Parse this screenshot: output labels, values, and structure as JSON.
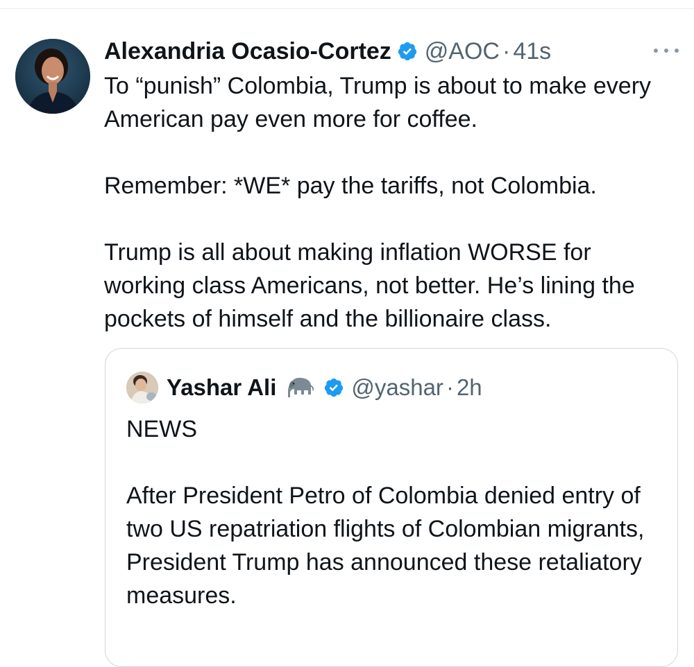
{
  "tweet": {
    "author_name": "Alexandria Ocasio-Cortez",
    "handle": "@AOC",
    "separator": "·",
    "time": "41s",
    "paragraphs": [
      "To “punish” Colombia, Trump is about to make every American pay even more for coffee.",
      "Remember: *WE* pay the tariffs, not Colombia.",
      "Trump is all about making inflation WORSE for working class Americans, not better. He’s lining the pockets of himself and the billionaire class."
    ],
    "verified_icon": "verified-badge-icon",
    "more_icon": "more-options-icon"
  },
  "quoted_tweet": {
    "author_name": "Yashar Ali",
    "author_emoji_icon": "elephant-icon",
    "handle": "@yashar",
    "separator": "·",
    "time": "2h",
    "paragraphs": [
      "NEWS",
      "After President Petro of Colombia denied entry of two US repatriation flights of Colombian migrants, President Trump has announced these retaliatory measures."
    ]
  },
  "colors": {
    "verified_blue": "#1d9bf0",
    "text_primary": "#0f1419",
    "text_secondary": "#536471",
    "border": "#cfd9de"
  }
}
